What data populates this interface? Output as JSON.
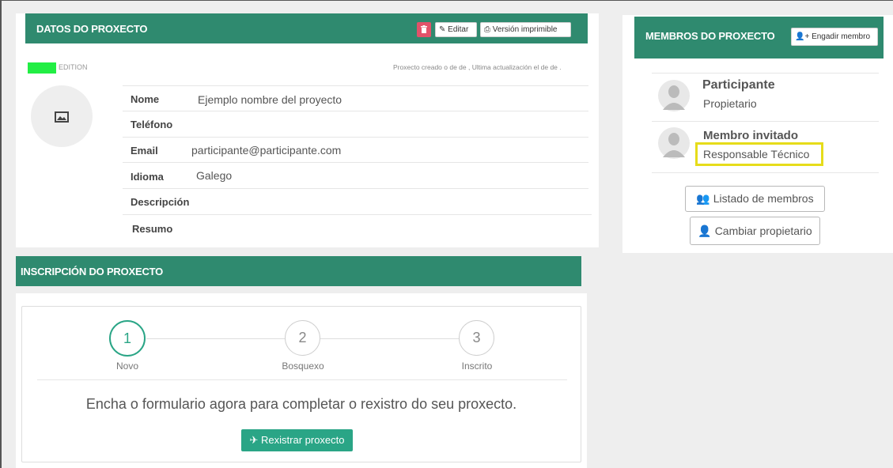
{
  "project": {
    "header_title": "DATOS DO PROXECTO",
    "edit_label": "Editar",
    "print_label": "Versión imprimible",
    "status_label": "EDITION",
    "meta_text": "Proxecto creado o de de , Ultima actualización el de de .",
    "fields": [
      {
        "label": "Nome",
        "value": "Ejemplo nombre del proyecto"
      },
      {
        "label": "Teléfono",
        "value": ""
      },
      {
        "label": "Email",
        "value": "participante@participante.com"
      },
      {
        "label": "Idioma",
        "value": "Galego"
      },
      {
        "label": "Descripción",
        "value": ""
      },
      {
        "label": "Resumo",
        "value": ""
      }
    ]
  },
  "members": {
    "header_title": "MEMBROS DO PROXECTO",
    "add_label": "Engadir membro",
    "list": [
      {
        "name": "Participante",
        "role": "Propietario"
      },
      {
        "name": "Membro invitado",
        "role": "Responsable Técnico"
      }
    ],
    "list_members_label": "Listado de membros",
    "change_owner_label": "Cambiar propietario"
  },
  "registration": {
    "header_title": "INSCRIPCIÓN DO PROXECTO",
    "steps": [
      {
        "number": "1",
        "label": "Novo"
      },
      {
        "number": "2",
        "label": "Bosquexo"
      },
      {
        "number": "3",
        "label": "Inscrito"
      }
    ],
    "message": "Encha o formulario agora para completar o rexistro do seu proxecto.",
    "register_label": "Rexistrar proxecto"
  },
  "colors": {
    "header": "#2f8a6f",
    "accent": "#2aa586",
    "status_badge": "#22ee44",
    "delete": "#e2526a",
    "highlight": "#e6dc1a"
  }
}
